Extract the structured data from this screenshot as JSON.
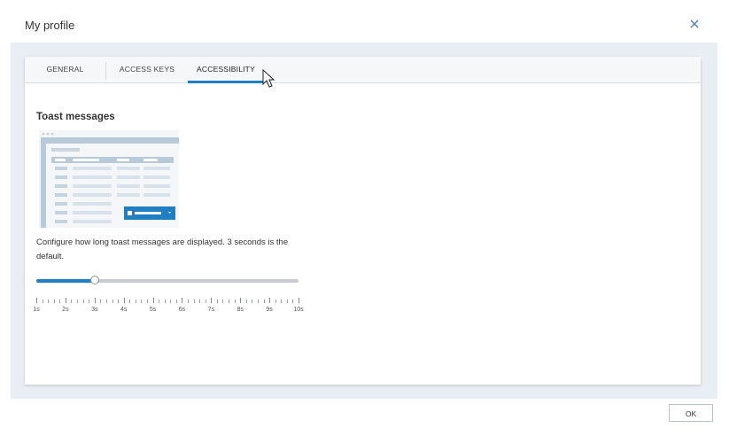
{
  "dialog": {
    "title": "My profile",
    "close_icon": "close-icon"
  },
  "tabs": [
    {
      "label": "GENERAL",
      "active": false
    },
    {
      "label": "ACCESS KEYS",
      "active": false
    },
    {
      "label": "ACCESSIBILITY",
      "active": true
    }
  ],
  "section": {
    "title": "Toast messages",
    "description": "Configure how long toast messages are displayed. 3 seconds is the default.",
    "preview_icon": "toast-preview-illustration"
  },
  "slider": {
    "min_seconds": 1,
    "max_seconds": 10,
    "value_seconds": 3,
    "labels": [
      "1s",
      "2s",
      "3s",
      "4s",
      "5s",
      "6s",
      "7s",
      "8s",
      "9s",
      "10s"
    ]
  },
  "footer": {
    "ok_label": "OK"
  },
  "colors": {
    "accent": "#1f7fc2",
    "panel_bg": "#e9eef4",
    "track": "#c8ccd0"
  }
}
